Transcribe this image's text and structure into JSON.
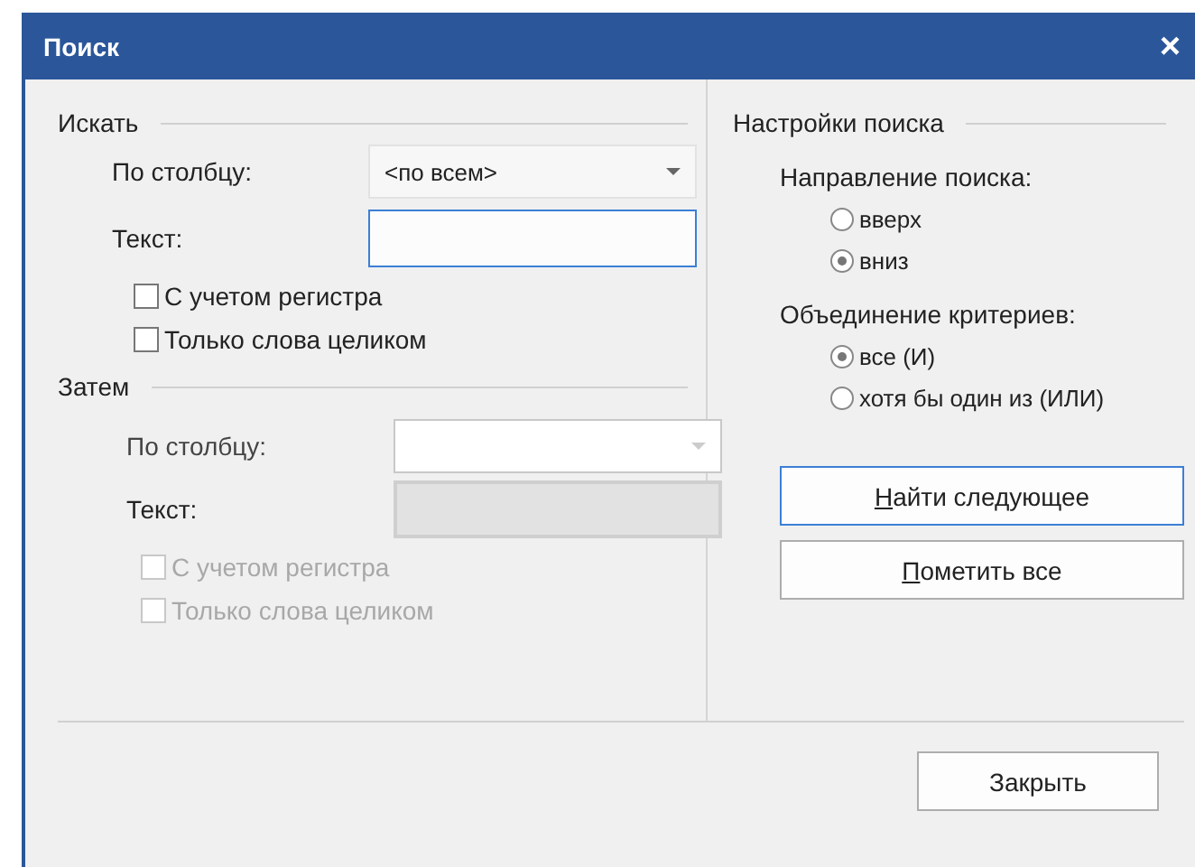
{
  "window": {
    "title": "Поиск",
    "close": "×"
  },
  "criteria": [
    {
      "heading": "Искать",
      "disabled": false,
      "column": {
        "label": "По столбцу:",
        "value": "<по всем>"
      },
      "text": {
        "label": "Текст:",
        "focused": true
      },
      "options": [
        {
          "label": "С учетом регистра",
          "checked": false
        },
        {
          "label": "Только слова целиком",
          "checked": false
        }
      ]
    },
    {
      "heading": "Затем",
      "disabled": true,
      "column": {
        "label": "По столбцу:"
      },
      "text": {
        "label": "Текст:",
        "focused": false
      },
      "options": [
        {
          "label": "С учетом регистра",
          "checked": false
        },
        {
          "label": "Только слова целиком",
          "checked": false
        }
      ]
    }
  ],
  "settings": {
    "heading": "Настройки поиска",
    "groups": [
      {
        "label": "Направление поиска:",
        "options": [
          {
            "label": "вверх",
            "selected": false
          },
          {
            "label": "вниз",
            "selected": true
          }
        ]
      },
      {
        "label": "Объединение критериев:",
        "options": [
          {
            "label": "все (И)",
            "selected": true
          },
          {
            "label": "хотя бы один из (ИЛИ)",
            "selected": false
          }
        ]
      }
    ]
  },
  "buttons": [
    {
      "label": "Найти следующее",
      "focused": true
    },
    {
      "label": "Пометить все",
      "focused": false
    }
  ],
  "close_button": "Закрыть"
}
